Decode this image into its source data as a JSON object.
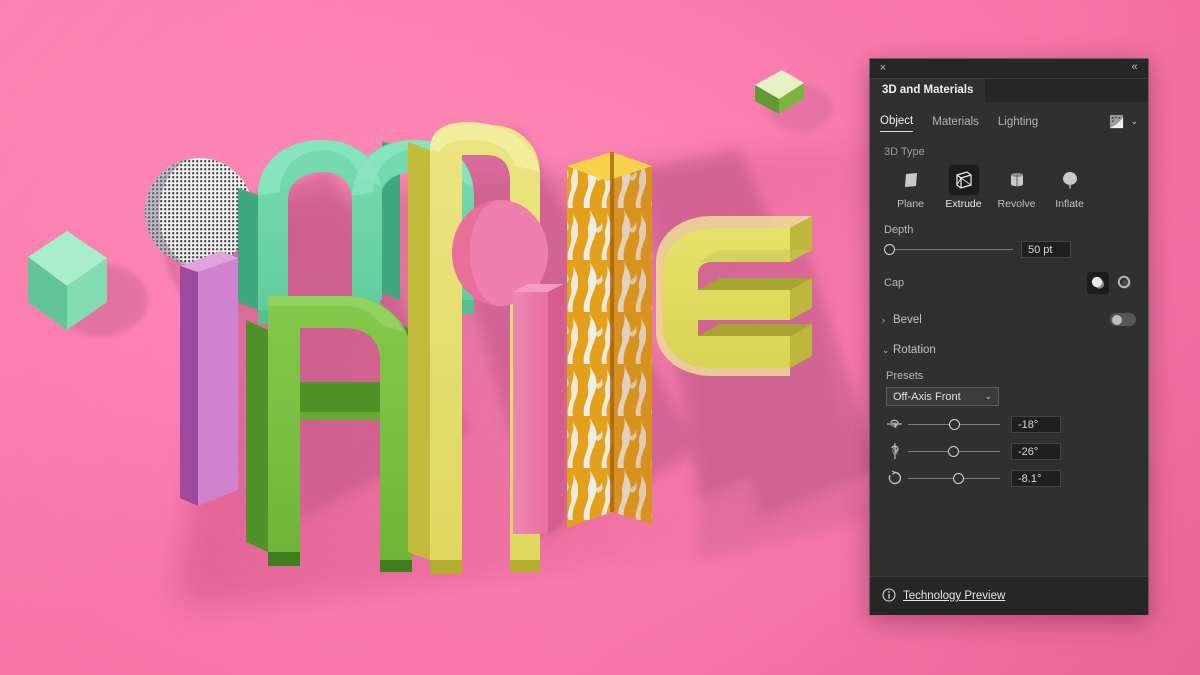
{
  "app": {
    "background_color": "#fc7fb0",
    "panel_bg": "#303030",
    "accent": "#d8d8d8"
  },
  "artwork": {
    "name": "3d-extruded-lettering",
    "word": "mobile",
    "letters": [
      {
        "glyph": "m",
        "color": "#6ed5a8",
        "side": "#49b385"
      },
      {
        "glyph": "a",
        "color": "#7cc242",
        "side": "#5da22c"
      },
      {
        "glyph": "o",
        "color": "#e8e06a",
        "side": "#cfc64e"
      },
      {
        "glyph": "b",
        "color": "#e8e06a",
        "side": "#cfc64e"
      },
      {
        "glyph": "i",
        "color": "#e8a81e",
        "side": "#d4860f"
      },
      {
        "glyph": "l",
        "color": "#e8e06a",
        "side": "#cfc64e"
      },
      {
        "glyph": "e",
        "color": "#e0e063",
        "side": "#c9c94b"
      }
    ],
    "props": [
      {
        "name": "green-cube-left",
        "color": "#7fe0b0"
      },
      {
        "name": "green-cube-top-right",
        "color": "#8ec04a"
      },
      {
        "name": "halftone-sphere",
        "color": "#e8e8e8"
      },
      {
        "name": "pink-circle",
        "color": "#ef7fae"
      },
      {
        "name": "magenta-bar",
        "color": "#c46ac0"
      }
    ]
  },
  "panel": {
    "title": "3D and Materials",
    "close_label": "×",
    "collapse_label": "«",
    "tabs": [
      {
        "label": "Object",
        "active": true
      },
      {
        "label": "Materials",
        "active": false
      },
      {
        "label": "Lighting",
        "active": false
      }
    ],
    "material_picker_icon": "material-thumbnail-icon",
    "material_chevron": "⌄",
    "type_section": {
      "label": "3D Type",
      "items": [
        {
          "label": "Plane",
          "icon": "plane-icon",
          "active": false
        },
        {
          "label": "Extrude",
          "icon": "extrude-icon",
          "active": true
        },
        {
          "label": "Revolve",
          "icon": "revolve-icon",
          "active": false
        },
        {
          "label": "Inflate",
          "icon": "inflate-icon",
          "active": false
        }
      ]
    },
    "depth": {
      "label": "Depth",
      "value": "50 pt",
      "slider_percent": 2
    },
    "cap": {
      "label": "Cap",
      "options": [
        {
          "name": "cap-solid-icon",
          "active": true
        },
        {
          "name": "cap-hollow-icon",
          "active": false
        }
      ]
    },
    "bevel": {
      "label": "Bevel",
      "expander": "›",
      "enabled": false
    },
    "rotation": {
      "label": "Rotation",
      "expander": "⌄",
      "presets_label": "Presets",
      "preset_value": "Off-Axis Front",
      "preset_chevron": "⌄",
      "axes": [
        {
          "name": "rotate-x-axis",
          "icon": "rotate-x-icon",
          "value": "-18°",
          "slider_percent": 50
        },
        {
          "name": "rotate-y-axis",
          "icon": "rotate-y-icon",
          "value": "-26°",
          "slider_percent": 49
        },
        {
          "name": "rotate-z-axis",
          "icon": "rotate-z-icon",
          "value": "-8.1°",
          "slider_percent": 53
        }
      ]
    },
    "footer": {
      "icon": "info-icon",
      "label": "Technology Preview"
    }
  }
}
